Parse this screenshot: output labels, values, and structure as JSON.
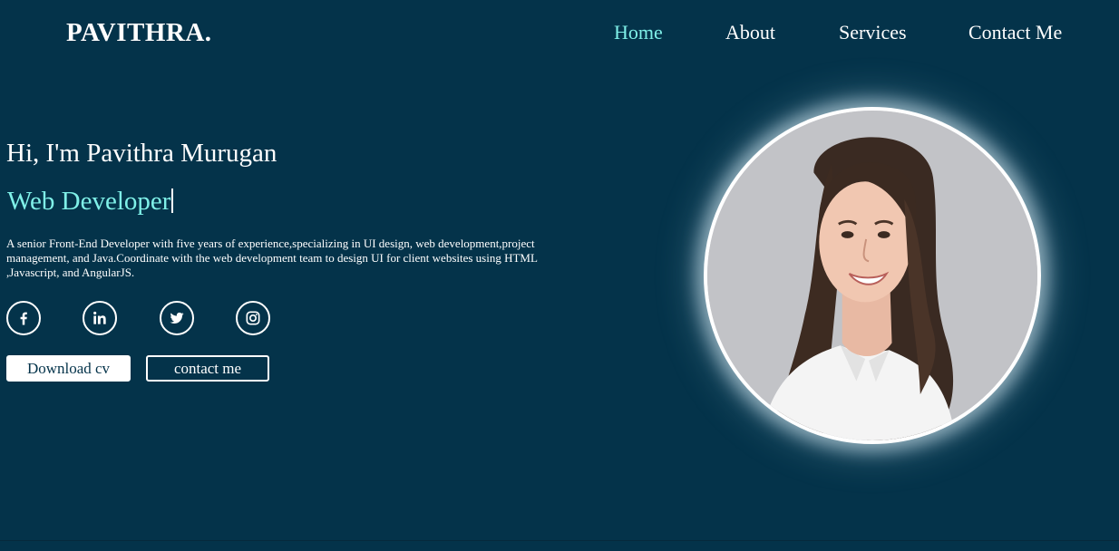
{
  "brand": {
    "logo_text": "PAVITHRA."
  },
  "nav": {
    "items": [
      {
        "label": "Home",
        "active": true
      },
      {
        "label": "About",
        "active": false
      },
      {
        "label": "Services",
        "active": false
      },
      {
        "label": "Contact Me",
        "active": false
      }
    ]
  },
  "hero": {
    "greeting": "Hi, I'm Pavithra Murugan",
    "role": "Web Developer",
    "bio": "A senior Front-End Developer with five years of experience,specializing in UI design, web development,project management, and Java.Coordinate with the web development team to design UI for client websites using HTML ,Javascript, and AngularJS.",
    "socials": [
      {
        "icon": "facebook-icon"
      },
      {
        "icon": "linkedin-icon"
      },
      {
        "icon": "twitter-icon"
      },
      {
        "icon": "instagram-icon"
      }
    ],
    "buttons": {
      "download_cv": "Download cv",
      "contact_me": "contact me"
    }
  },
  "portrait": {
    "icon": "profile-photo"
  },
  "colors": {
    "background": "#04334a",
    "accent": "#7ff0e8",
    "text": "#ffffff"
  }
}
